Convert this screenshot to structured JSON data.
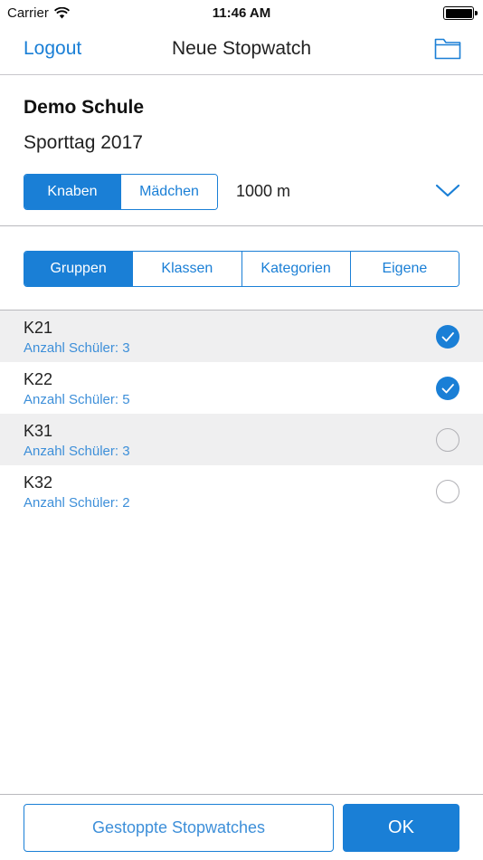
{
  "status_bar": {
    "carrier": "Carrier",
    "time": "11:46 AM"
  },
  "nav": {
    "left_label": "Logout",
    "title": "Neue Stopwatch",
    "right_icon": "folder-icon"
  },
  "header": {
    "school": "Demo Schule",
    "event": "Sporttag 2017",
    "gender_options": [
      {
        "label": "Knaben",
        "selected": true
      },
      {
        "label": "Mädchen",
        "selected": false
      }
    ],
    "distance": "1000 m"
  },
  "filter_tabs": [
    {
      "label": "Gruppen",
      "selected": true
    },
    {
      "label": "Klassen",
      "selected": false
    },
    {
      "label": "Kategorien",
      "selected": false
    },
    {
      "label": "Eigene",
      "selected": false
    }
  ],
  "groups": [
    {
      "name": "K21",
      "subtitle": "Anzahl Schüler: 3",
      "checked": true
    },
    {
      "name": "K22",
      "subtitle": "Anzahl Schüler: 5",
      "checked": true
    },
    {
      "name": "K31",
      "subtitle": "Anzahl Schüler: 3",
      "checked": false
    },
    {
      "name": "K32",
      "subtitle": "Anzahl Schüler: 2",
      "checked": false
    }
  ],
  "footer": {
    "secondary_label": "Gestoppte Stopwatches",
    "primary_label": "OK"
  },
  "colors": {
    "accent": "#1a7fd6",
    "subtitle": "#3d8fd9",
    "row_shade": "#efeff0"
  }
}
